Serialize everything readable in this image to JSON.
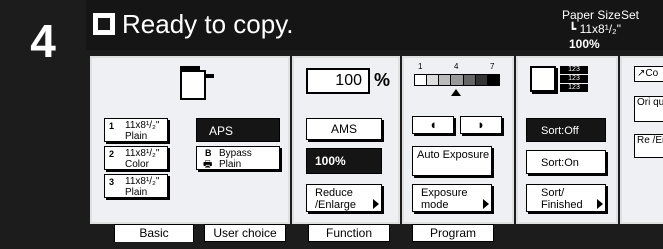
{
  "step_number": "4",
  "header": {
    "status_text": "Ready to copy.",
    "paper_size_label": "Paper Size",
    "paper_size_value": "11x8¹/₂\"",
    "zoom_value": "100%",
    "set_label": "Set"
  },
  "paper": {
    "trays": [
      {
        "num": "1",
        "size": "11x8¹/₂\"",
        "type": "Plain"
      },
      {
        "num": "2",
        "size": "11x8¹/₂\"",
        "type": "Color"
      },
      {
        "num": "3",
        "size": "11x8¹/₂\"",
        "type": "Plain"
      }
    ],
    "aps_label": "APS",
    "bypass": {
      "num": "B",
      "label": "Bypass",
      "type": "Plain"
    }
  },
  "zoom": {
    "value": "100",
    "unit": "%",
    "ams_label": "AMS",
    "preset_label": "100%",
    "reduce_label": "Reduce /Enlarge"
  },
  "exposure": {
    "scale_labels": [
      "1",
      "4",
      "7"
    ],
    "auto_label": "Auto Exposure",
    "mode_label": "Exposure mode",
    "level": 4
  },
  "sort": {
    "stack_labels": [
      "123",
      "123",
      "123"
    ],
    "sort_off": "Sort:Off",
    "sort_on": "Sort:On",
    "sort_finished": "Sort/ Finished"
  },
  "right_buttons": [
    {
      "label": "Co"
    },
    {
      "label": "Ori qua"
    },
    {
      "label": "Re /En"
    }
  ],
  "tabs": [
    "Basic",
    "User choice",
    "Function",
    "Program"
  ],
  "colors": {
    "panel": "#1c1c1c",
    "pane_bg": "#eef0f4",
    "selected": "#151515"
  }
}
